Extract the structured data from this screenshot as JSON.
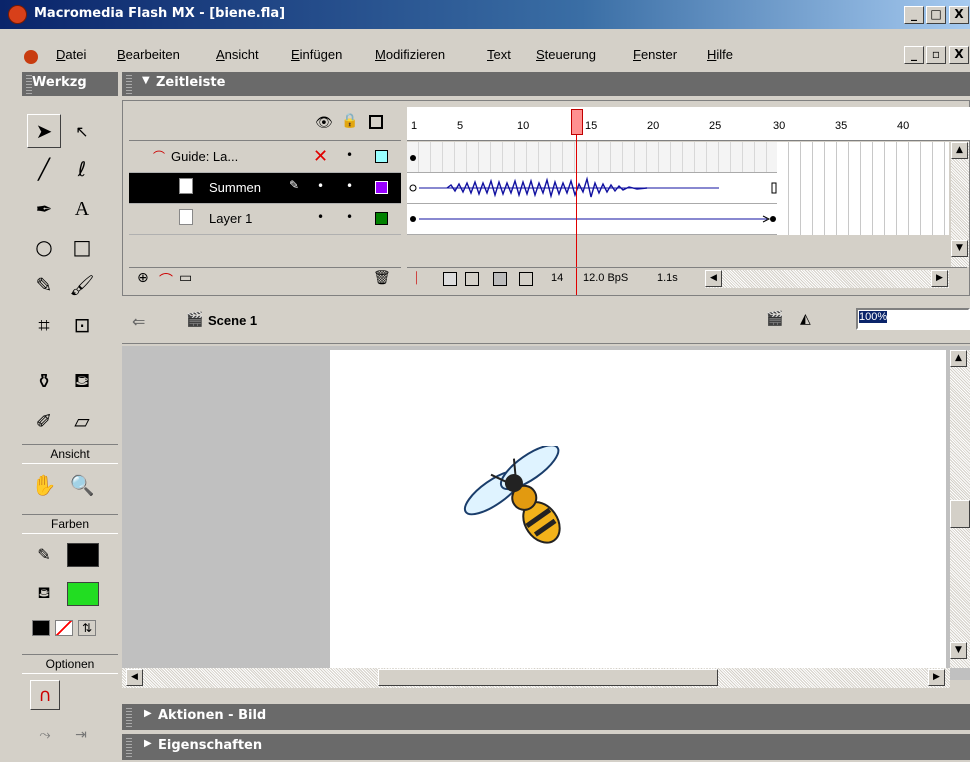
{
  "window": {
    "title": "Macromedia Flash MX - [biene.fla]"
  },
  "menu": [
    "Datei",
    "Bearbeiten",
    "Ansicht",
    "Einfügen",
    "Modifizieren",
    "Text",
    "Steuerung",
    "Fenster",
    "Hilfe"
  ],
  "panels": {
    "tools": "Werkzg",
    "timeline": "Zeitleiste",
    "actions": "Aktionen - Bild",
    "properties": "Eigenschaften"
  },
  "tools": {
    "view_label": "Ansicht",
    "colors_label": "Farben",
    "options_label": "Optionen",
    "stroke_color": "#000000",
    "fill_color": "#22dd22"
  },
  "timeline": {
    "ruler": [
      "1",
      "5",
      "10",
      "15",
      "20",
      "25",
      "30",
      "35",
      "40"
    ],
    "playhead_frame": 14,
    "layers": [
      {
        "name": "Guide: La...",
        "color": "#99ffff",
        "active": false
      },
      {
        "name": "Summen",
        "color": "#9900ff",
        "active": true
      },
      {
        "name": "Layer 1",
        "color": "#008000",
        "active": false
      }
    ],
    "status": {
      "frame": "14",
      "fps": "12.0 BpS",
      "time": "1.1s"
    }
  },
  "edit_bar": {
    "scene": "Scene 1",
    "zoom": "100%"
  }
}
